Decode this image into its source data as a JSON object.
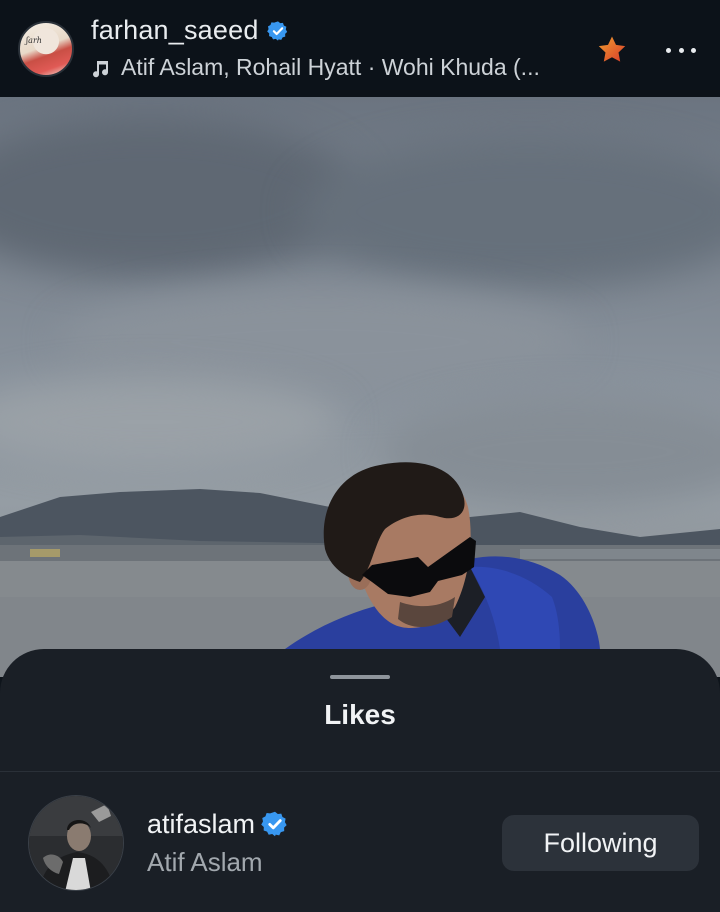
{
  "header": {
    "username": "farhan_saeed",
    "music": "Atif Aslam, Rohail Hyatt · Wohi Khuda (..."
  },
  "sheet": {
    "title": "Likes",
    "likes": [
      {
        "username": "atifaslam",
        "full_name": "Atif Aslam",
        "button_label": "Following"
      }
    ]
  },
  "icons": {
    "verified": "verified-badge-icon",
    "music": "music-note-icon",
    "favorite": "star-icon",
    "more": "more-dots-icon"
  },
  "colors": {
    "verified": "#3897f0",
    "star": "#e0502a",
    "header_bg": "#0c1219",
    "sheet_bg": "#1a1f26",
    "button_bg": "#2c323a"
  }
}
